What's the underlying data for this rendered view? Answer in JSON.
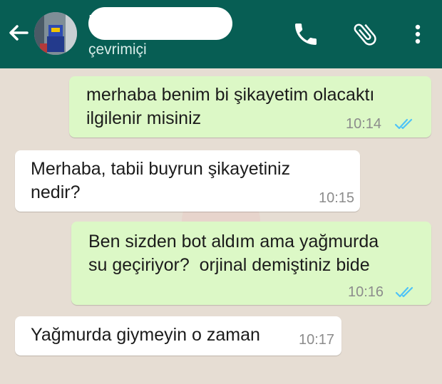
{
  "header": {
    "contact_name_visible": "N",
    "status": "çevrimiçi",
    "colors": {
      "bar": "#075e54",
      "outgoing_bubble": "#dcf8c6",
      "incoming_bubble": "#ffffff",
      "read_ticks": "#4fc3f7"
    },
    "icons": [
      "back-arrow-icon",
      "phone-icon",
      "paperclip-icon",
      "more-vert-icon"
    ]
  },
  "messages": [
    {
      "direction": "outgoing",
      "text": "merhaba benim bi şikayetim olacaktı\nilgilenir misiniz",
      "time": "10:14",
      "read": true
    },
    {
      "direction": "incoming",
      "text": "Merhaba, tabii buyrun şikayetiniz\nnedir?",
      "time": "10:15"
    },
    {
      "direction": "outgoing",
      "text": "Ben sizden bot aldım ama yağmurda\nsu geçiriyor?  orjinal demiştiniz bide",
      "time": "10:16",
      "read": true
    },
    {
      "direction": "incoming",
      "text": "Yağmurda giymeyin o zaman",
      "time": "10:17"
    }
  ]
}
